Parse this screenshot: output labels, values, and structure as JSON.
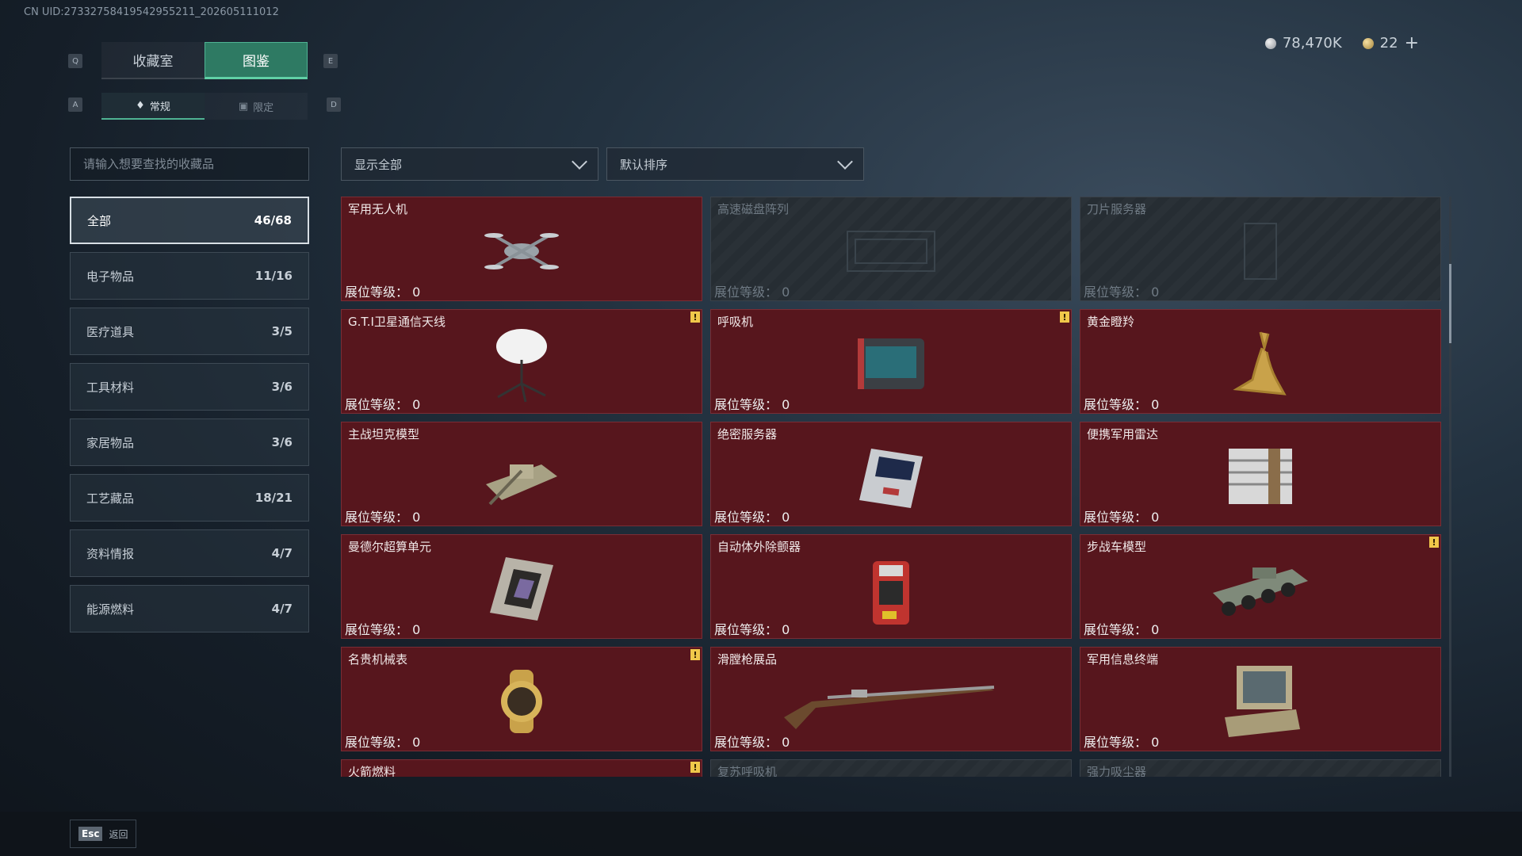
{
  "uid": "CN UID:27332758419542955211_202605111012",
  "currency": {
    "silver": "78,470K",
    "gold": "22",
    "plus": "+"
  },
  "keys": {
    "q": "Q",
    "e": "E",
    "a": "A",
    "d": "D"
  },
  "tabs": [
    {
      "label": "收藏室"
    },
    {
      "label": "图鉴"
    }
  ],
  "subtabs": [
    {
      "label": "常规"
    },
    {
      "label": "限定"
    }
  ],
  "search": {
    "placeholder": "请输入想要查找的收藏品"
  },
  "filters": {
    "show": "显示全部",
    "sort": "默认排序"
  },
  "categories": [
    {
      "label": "全部",
      "count": "46/68"
    },
    {
      "label": "电子物品",
      "count": "11/16"
    },
    {
      "label": "医疗道具",
      "count": "3/5"
    },
    {
      "label": "工具材料",
      "count": "3/6"
    },
    {
      "label": "家居物品",
      "count": "3/6"
    },
    {
      "label": "工艺藏品",
      "count": "18/21"
    },
    {
      "label": "资料情报",
      "count": "4/7"
    },
    {
      "label": "能源燃料",
      "count": "4/7"
    }
  ],
  "level_label": "展位等级： 0",
  "items": [
    {
      "name": "军用无人机"
    },
    {
      "name": "高速磁盘阵列"
    },
    {
      "name": "刀片服务器"
    },
    {
      "name": "G.T.I卫星通信天线"
    },
    {
      "name": "呼吸机"
    },
    {
      "name": "黄金瞪羚"
    },
    {
      "name": "主战坦克模型"
    },
    {
      "name": "绝密服务器"
    },
    {
      "name": "便携军用雷达"
    },
    {
      "name": "曼德尔超算单元"
    },
    {
      "name": "自动体外除颤器"
    },
    {
      "name": "步战车模型"
    },
    {
      "name": "名贵机械表"
    },
    {
      "name": "滑膛枪展品"
    },
    {
      "name": "军用信息终端"
    },
    {
      "name": "火箭燃料"
    },
    {
      "name": "复苏呼吸机"
    },
    {
      "name": "强力吸尘器"
    }
  ],
  "warn_mark": "!",
  "footer": {
    "esc_key": "Esc",
    "esc_label": "返回"
  }
}
